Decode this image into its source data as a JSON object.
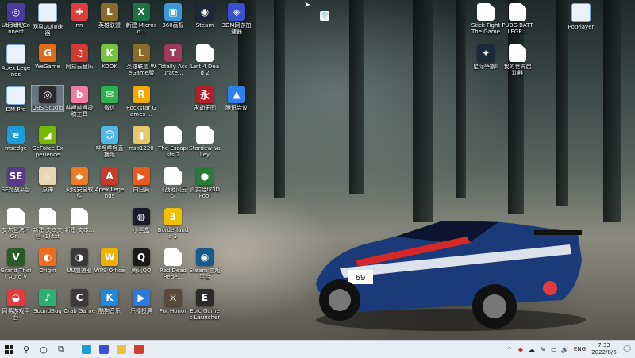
{
  "desktop": {
    "icons": [
      {
        "label": "回收站",
        "glyph": "🗑",
        "color": "#cfe3f7"
      },
      {
        "label": "网易UU加速器",
        "glyph": "",
        "color": "#e9f2fb"
      },
      {
        "label": "nn",
        "glyph": "✚",
        "color": "#e23b3b"
      },
      {
        "label": "英雄联盟",
        "glyph": "L",
        "color": "#8a6b2a"
      },
      {
        "label": "新建 Microso...",
        "glyph": "X",
        "color": "#1d7245"
      },
      {
        "label": "360画报",
        "glyph": "▣",
        "color": "#3a9ad9"
      },
      {
        "label": "Steam",
        "glyph": "◉",
        "color": "#1b2838"
      },
      {
        "label": "3DM网游加速器",
        "glyph": "◈",
        "color": "#3a4fd1"
      },
      {
        "label": "Stick Fight The Game",
        "glyph": "",
        "color": "#ffffff"
      },
      {
        "label": "PUBG BATTLEGR...",
        "glyph": "",
        "color": "#ffffff"
      },
      {
        "label": "PotPlayer",
        "glyph": "",
        "color": "#e9f2fb"
      },
      {
        "label": "Apex Legends",
        "glyph": "",
        "color": "#e9f2fb"
      },
      {
        "label": "WeGame",
        "glyph": "G",
        "color": "#e06a1a"
      },
      {
        "label": "网易云音乐",
        "glyph": "♫",
        "color": "#d33a31"
      },
      {
        "label": "KOOK",
        "glyph": "K",
        "color": "#7ac142"
      },
      {
        "label": "英雄联盟 WeGame版",
        "glyph": "L",
        "color": "#8a6b2a"
      },
      {
        "label": "Totally Accurate...",
        "glyph": "T",
        "color": "#a03a5a"
      },
      {
        "label": "Left 4 Dead 2",
        "glyph": "",
        "color": "#ffffff"
      },
      {
        "label": "星际争霸II",
        "glyph": "✦",
        "color": "#1a2a3a"
      },
      {
        "label": "我的世界启动器",
        "glyph": "",
        "color": "#ffffff"
      },
      {
        "label": "DM Pro",
        "glyph": "",
        "color": "#e9f2fb"
      },
      {
        "label": "OBS Studio",
        "glyph": "◎",
        "color": "#2b2b2b"
      },
      {
        "label": "哔哩哔哩投稿工具",
        "glyph": "b",
        "color": "#f07aa0"
      },
      {
        "label": "微信",
        "glyph": "✉",
        "color": "#2bb24c"
      },
      {
        "label": "Rockstar Games ...",
        "glyph": "R",
        "color": "#f2a900"
      },
      {
        "label": "永劫无间",
        "glyph": "永",
        "color": "#b4202a"
      },
      {
        "label": "腾讯会议",
        "glyph": "▲",
        "color": "#2d7ff0"
      },
      {
        "label": "msedge",
        "glyph": "e",
        "color": "#1f9bd8"
      },
      {
        "label": "GeForce Experience",
        "glyph": "◢",
        "color": "#76b900"
      },
      {
        "label": "哔哩哔哩直播姬",
        "glyph": "☺",
        "color": "#4fb8e8"
      },
      {
        "label": "rrsp1220",
        "glyph": "▮",
        "color": "#e8c66a"
      },
      {
        "label": "The Escapists 2",
        "glyph": "",
        "color": "#ffffff"
      },
      {
        "label": "Stardew Valley",
        "glyph": "",
        "color": "#ffffff"
      },
      {
        "label": "SE对战平台",
        "glyph": "SE",
        "color": "#5a3a8a"
      },
      {
        "label": "原神",
        "glyph": "☆",
        "color": "#e9d6b4"
      },
      {
        "label": "火绒安全软件",
        "glyph": "◆",
        "color": "#f07a20"
      },
      {
        "label": "Apex Legends",
        "glyph": "A",
        "color": "#c73a2a"
      },
      {
        "label": "向日葵",
        "glyph": "▶",
        "color": "#e85a20"
      },
      {
        "label": "《战地风云 5",
        "glyph": "",
        "color": "#ffffff"
      },
      {
        "label": "真实台球3D Pool",
        "glyph": "●",
        "color": "#2a7a3a"
      },
      {
        "label": "艾尔登法环 Gr...",
        "glyph": "",
        "color": "#ffffff"
      },
      {
        "label": "新建 文本文档 (1).txt",
        "glyph": "",
        "color": "#ffffff"
      },
      {
        "label": "新建 文本...",
        "glyph": "",
        "color": "#ffffff"
      },
      {
        "label": "小黑盒",
        "glyph": "◍",
        "color": "#1a1a2a"
      },
      {
        "label": "Borderlands 3",
        "glyph": "3",
        "color": "#f0c000"
      },
      {
        "label": "Grand Theft Auto V",
        "glyph": "V",
        "color": "#2a5a2a"
      },
      {
        "label": "Origin",
        "glyph": "◐",
        "color": "#f06a20"
      },
      {
        "label": "UU加速器",
        "glyph": "◑",
        "color": "#3a3a3a"
      },
      {
        "label": "WPS Office",
        "glyph": "W",
        "color": "#f0b000"
      },
      {
        "label": "腾讯QQ",
        "glyph": "Q",
        "color": "#1a1a1a"
      },
      {
        "label": "Red Dead Rede...",
        "glyph": "",
        "color": "#ffffff"
      },
      {
        "label": "Steam 游戏平台",
        "glyph": "◉",
        "color": "#1b5a8a"
      },
      {
        "label": "网易游戏平台",
        "glyph": "◒",
        "color": "#e23b3b"
      },
      {
        "label": "SoundBug",
        "glyph": "♪",
        "color": "#2ab070"
      },
      {
        "label": "Crab Game",
        "glyph": "C",
        "color": "#3a3a3a"
      },
      {
        "label": "酷狗音乐",
        "glyph": "K",
        "color": "#1a8ae0"
      },
      {
        "label": "乐播投屏",
        "glyph": "▶",
        "color": "#2a7ae0"
      },
      {
        "label": "For Honor",
        "glyph": "⚔",
        "color": "#5a4a3a"
      },
      {
        "label": "Epic Games Launcher",
        "glyph": "E",
        "color": "#2a2a2a"
      },
      {
        "label": "Ubisoft Connect",
        "glyph": "◎",
        "color": "#4a3aa0"
      }
    ]
  },
  "taskbar": {
    "start_icon": "windows-logo",
    "search_icon": "search",
    "taskview_icon": "task-view",
    "pinned": [
      {
        "name": "edge",
        "color": "#1f9bd8"
      },
      {
        "name": "steam-like",
        "color": "#3a4fd1"
      },
      {
        "name": "file-explorer",
        "color": "#f0c040"
      },
      {
        "name": "netease-music",
        "color": "#d33a31"
      }
    ],
    "tray": {
      "chevron": "^",
      "lang": "ENG",
      "time": "7:33",
      "date": "2022/8/6"
    }
  }
}
